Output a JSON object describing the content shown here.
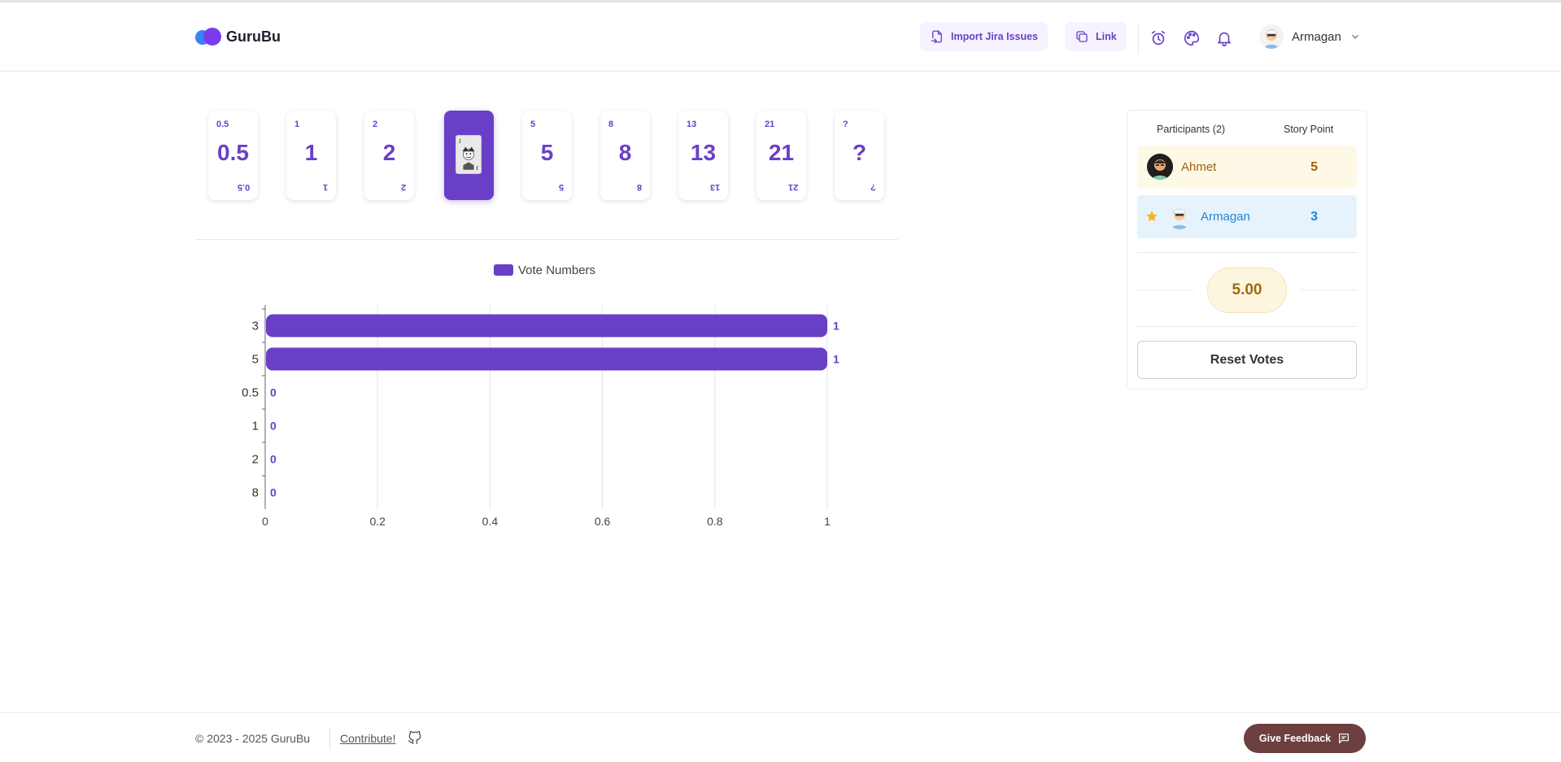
{
  "header": {
    "logo_text": "GuruBu",
    "import_label": "Import Jira Issues",
    "link_label": "Link",
    "user_name": "Armagan",
    "icons": [
      "alarm-clock-icon",
      "palette-icon",
      "bell-icon",
      "chevron-down-icon"
    ]
  },
  "cards": [
    {
      "value": "0.5",
      "selected": false
    },
    {
      "value": "1",
      "selected": false
    },
    {
      "value": "2",
      "selected": false
    },
    {
      "value": "",
      "selected": true,
      "face": "joker"
    },
    {
      "value": "5",
      "selected": false
    },
    {
      "value": "8",
      "selected": false
    },
    {
      "value": "13",
      "selected": false
    },
    {
      "value": "21",
      "selected": false
    },
    {
      "value": "?",
      "selected": false
    }
  ],
  "chart_data": {
    "type": "bar",
    "orientation": "horizontal",
    "categories": [
      "3",
      "5",
      "0.5",
      "1",
      "2",
      "8"
    ],
    "series": [
      {
        "name": "Vote Numbers",
        "values": [
          1,
          1,
          0,
          0,
          0,
          0
        ]
      }
    ],
    "xlim": [
      0,
      1
    ],
    "xticks": [
      "0",
      "0.2",
      "0.4",
      "0.6",
      "0.8",
      "1"
    ],
    "grid": "vertical",
    "legend": "top",
    "data_labels": true,
    "color": "#6a3fc8"
  },
  "panel": {
    "participants_header": "Participants (2)",
    "story_point_header": "Story Point",
    "participants": [
      {
        "name": "Ahmet",
        "score": "5",
        "bg": "#fdf9e6",
        "color": "#a0620c",
        "star": false
      },
      {
        "name": "Armagan",
        "score": "3",
        "bg": "#e6f3fc",
        "color": "#2186d6",
        "star": true
      }
    ],
    "average": "5.00",
    "reset_label": "Reset Votes"
  },
  "footer": {
    "copyright": "© 2023 - 2025 GuruBu",
    "contribute": "Contribute!",
    "feedback": "Give Feedback"
  }
}
